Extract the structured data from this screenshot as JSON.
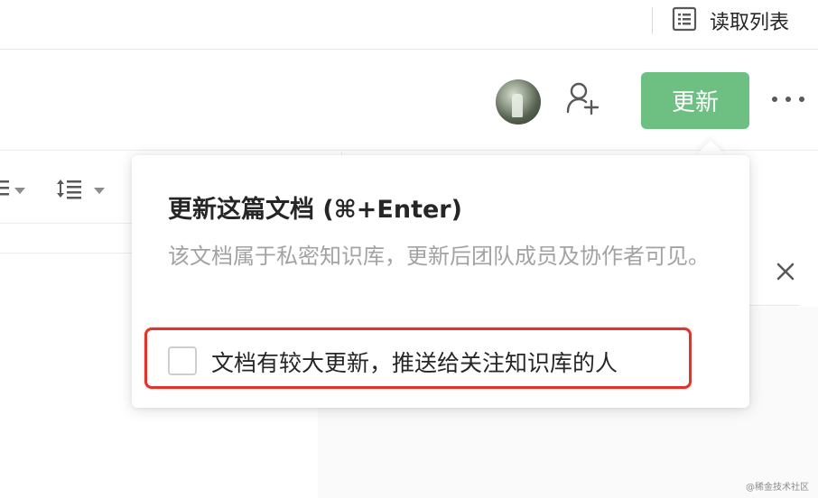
{
  "topbar": {
    "reading_list_label": "读取列表",
    "reading_list_icon": "list-icon"
  },
  "header": {
    "avatar_icon": "avatar",
    "add_collaborator_icon": "add-user-icon",
    "update_button_label": "更新",
    "more_icon": "more-horizontal-icon",
    "accent_color": "#6dc082"
  },
  "toolbar": {
    "list_icon": "unordered-list-icon",
    "indent_icon": "line-spacing-icon"
  },
  "side_panel": {
    "close_icon": "close-icon"
  },
  "popover": {
    "title": "更新这篇文档 (⌘+Enter)",
    "description": "该文档属于私密知识库，更新后团队成员及协作者可见。",
    "option_label": "文档有较大更新，推送给关注知识库的人",
    "option_checked": false,
    "highlight_color": "#e0352b"
  },
  "watermark": "@稀金技术社区"
}
